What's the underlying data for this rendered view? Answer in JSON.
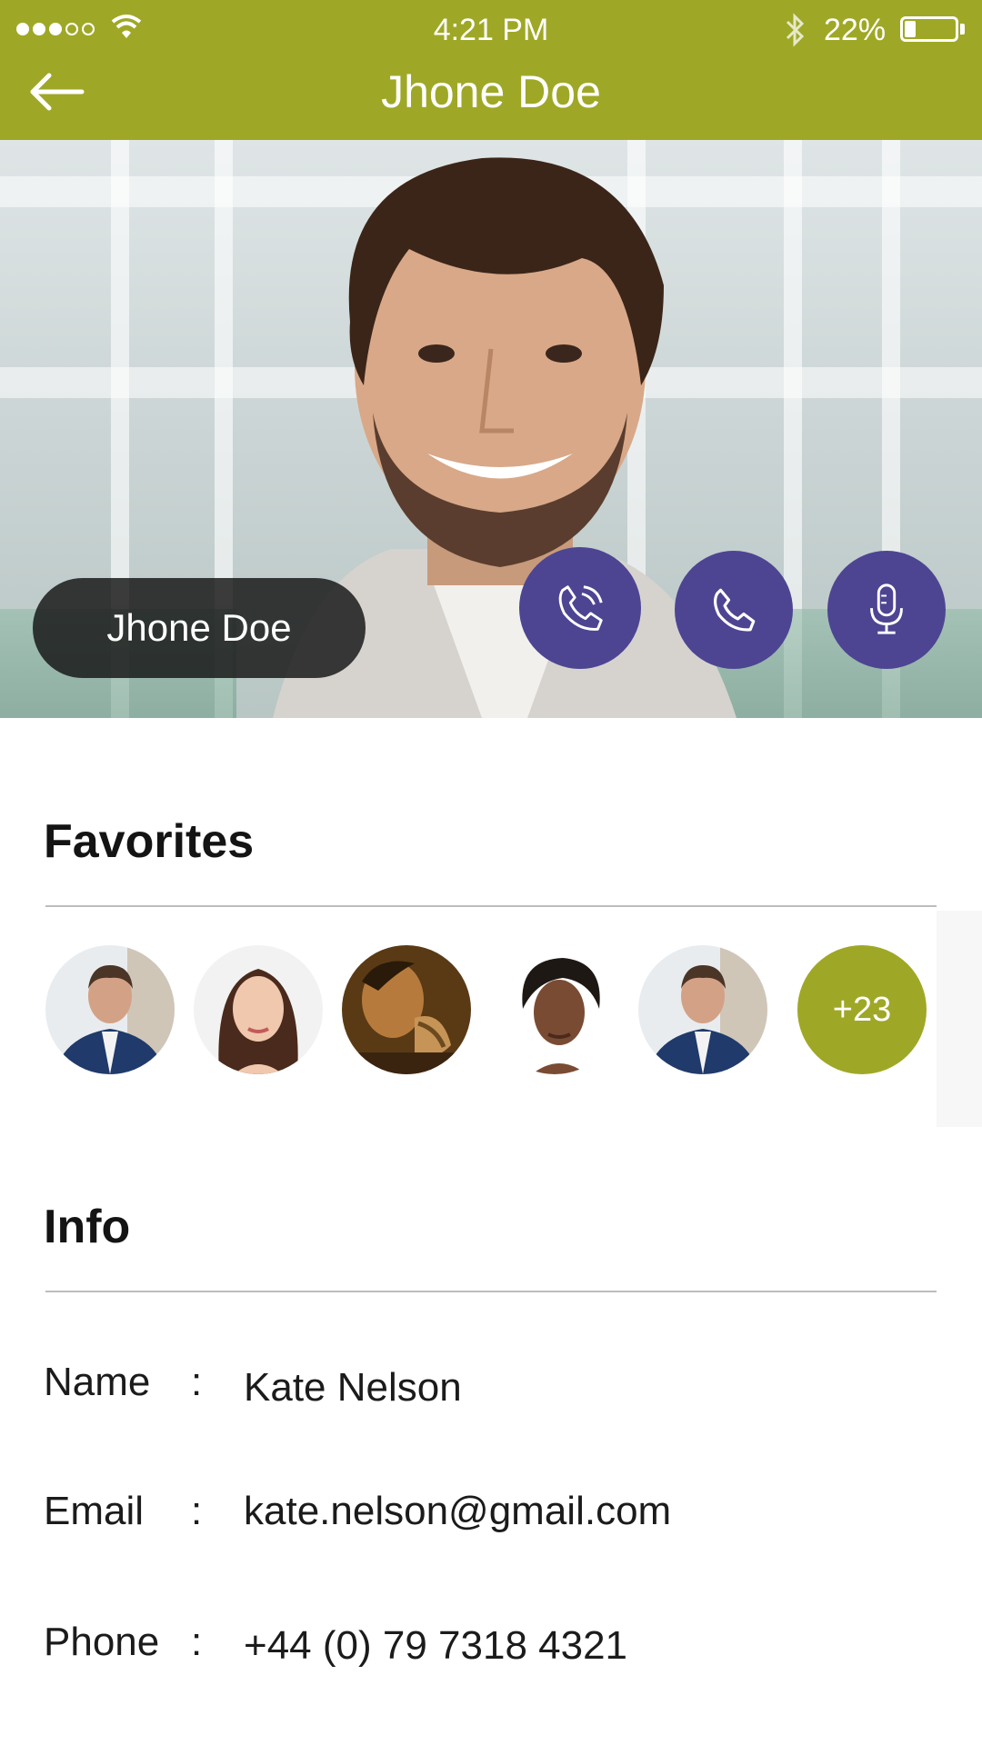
{
  "status_bar": {
    "time": "4:21 PM",
    "battery": "22%",
    "battery_level": 0.22
  },
  "header": {
    "title": "Jhone Doe",
    "back_icon": "arrow-left-icon",
    "color": "#9fa826"
  },
  "profile": {
    "name": "Jhone Doe",
    "actions": [
      {
        "icon": "phone-ringing-icon"
      },
      {
        "icon": "phone-icon"
      },
      {
        "icon": "microphone-icon"
      }
    ],
    "action_color": "#4d4592"
  },
  "favorites": {
    "heading": "Favorites",
    "avatars": [
      "man-suit",
      "woman-brunette",
      "man-rope",
      "woman-curly",
      "man-suit"
    ],
    "more_label": "+23"
  },
  "info": {
    "heading": "Info",
    "rows": [
      {
        "label": "Name",
        "sep": ":",
        "value": "Kate Nelson"
      },
      {
        "label": "Email",
        "sep": ":",
        "value": "kate.nelson@gmail.com"
      },
      {
        "label": "Phone",
        "sep": ":",
        "value": "+44 (0) 79 7318 4321"
      }
    ]
  }
}
